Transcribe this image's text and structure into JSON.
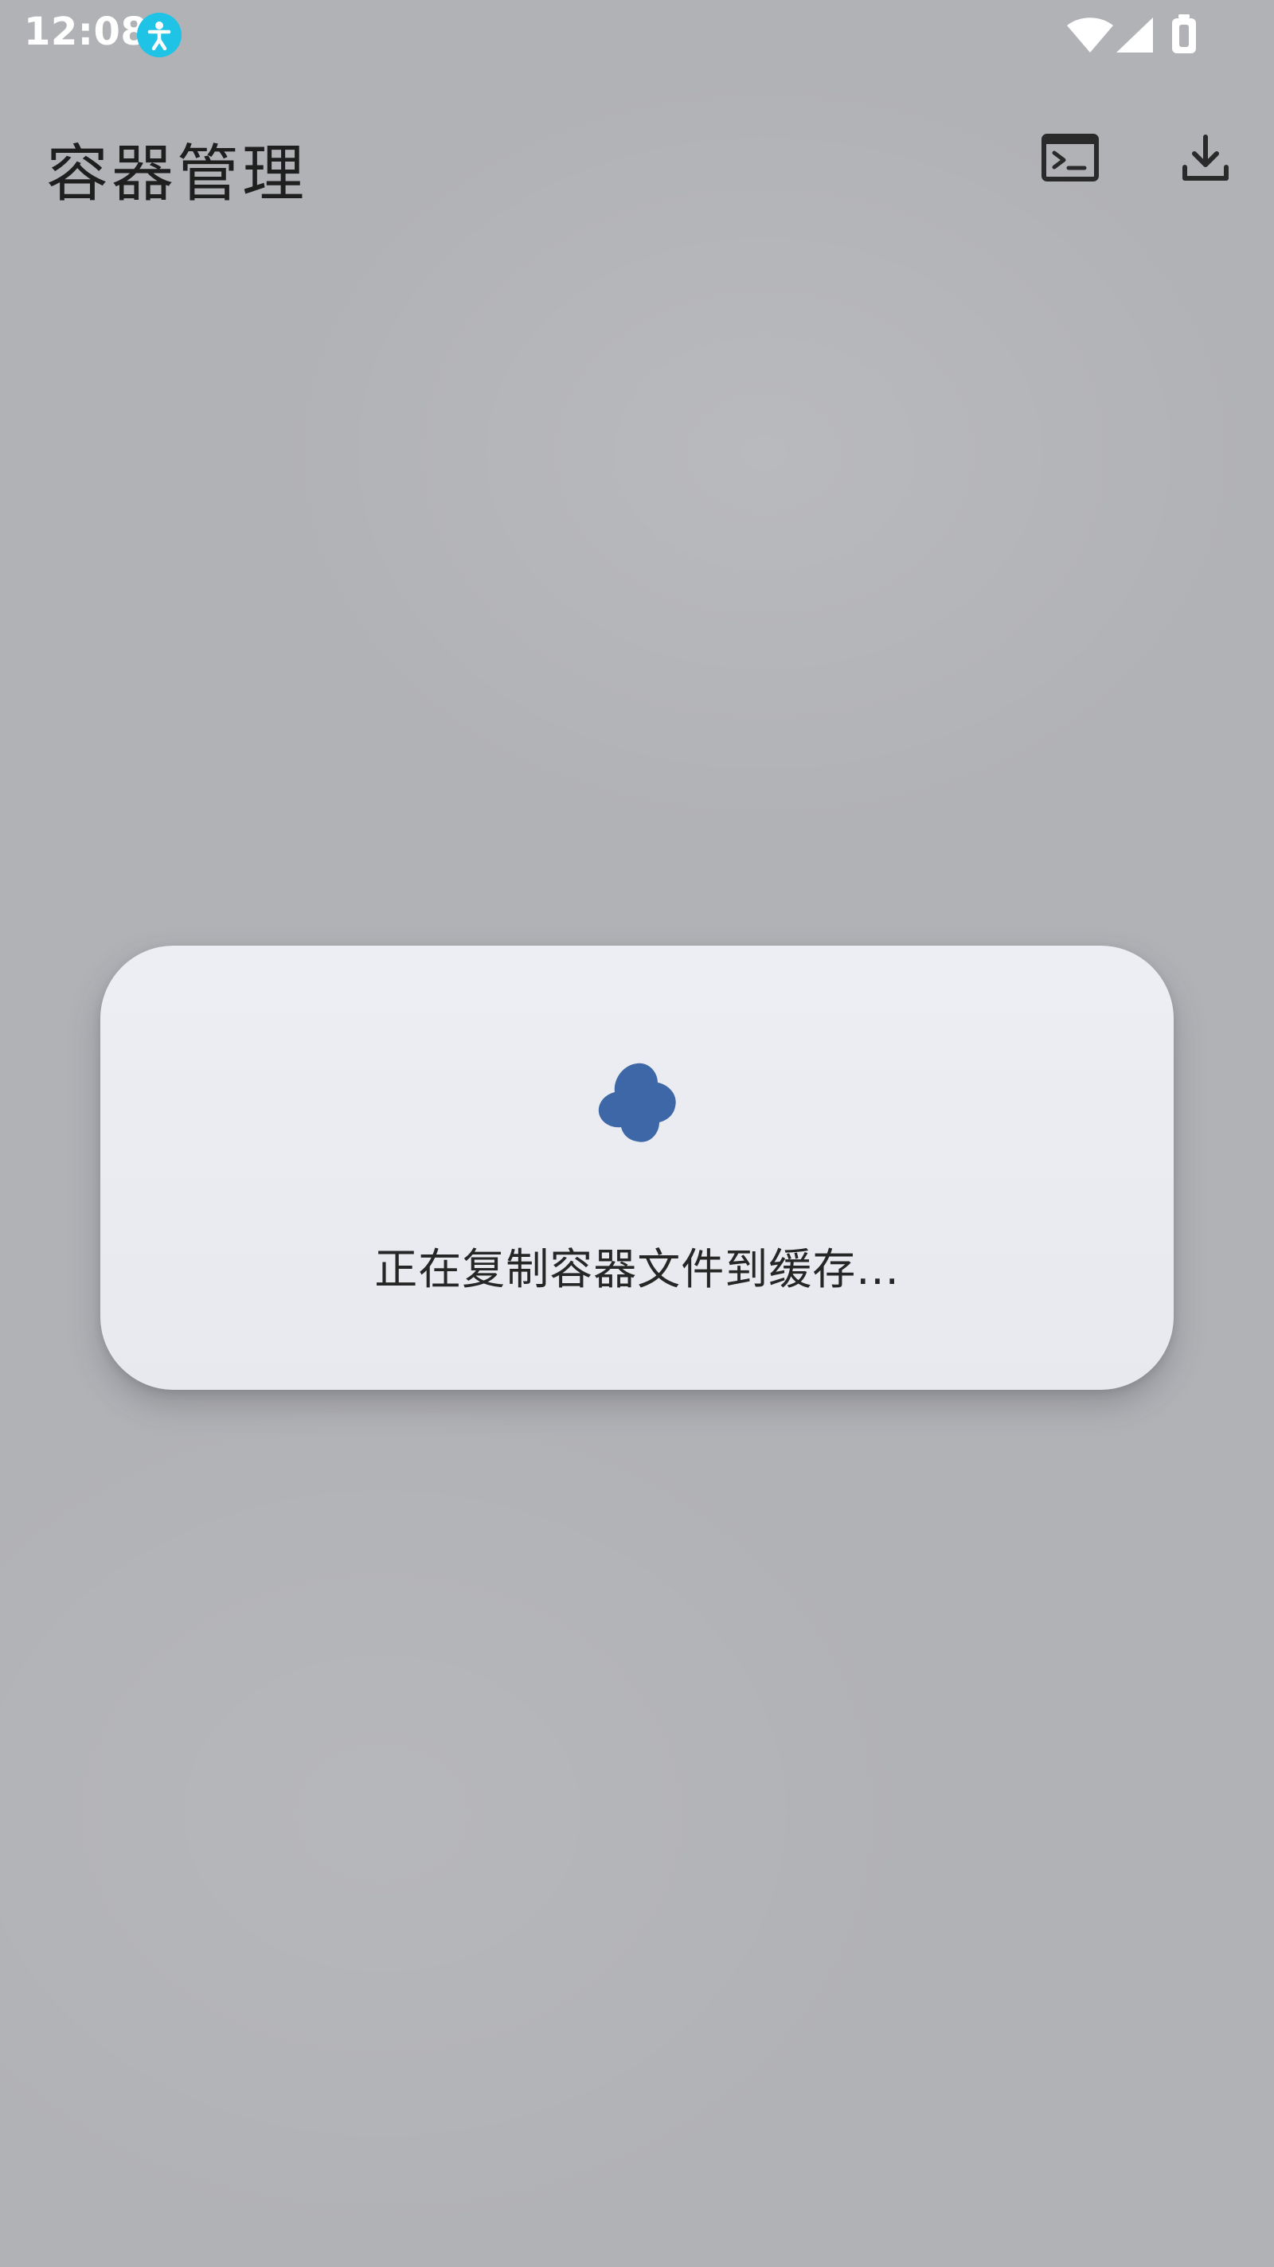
{
  "status_bar": {
    "time": "12:08",
    "icons": {
      "app": "accessibility-icon",
      "wifi": "wifi-icon",
      "signal": "cellular-signal-icon",
      "battery": "battery-icon"
    }
  },
  "app_bar": {
    "title": "容器管理",
    "actions": [
      {
        "icon": "terminal-icon"
      },
      {
        "icon": "download-icon"
      }
    ]
  },
  "dialog": {
    "indicator": "loading-spinner-icon",
    "message": "正在复制容器文件到缓存...",
    "indicator_color": "#3d67a6"
  },
  "colors": {
    "background": "#b1b2b6",
    "dialog_surface": "#eceef3",
    "title_text": "#1f1f1f",
    "status_accent": "#1ec3e6"
  }
}
